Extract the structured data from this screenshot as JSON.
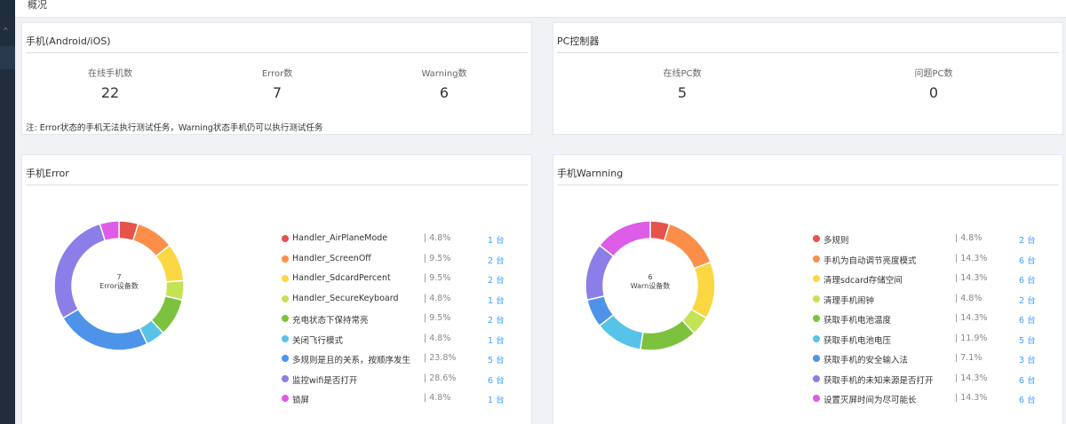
{
  "breadcrumb": "概况",
  "phones": {
    "title": "手机(Android/iOS)",
    "stats": [
      {
        "label": "在线手机数",
        "value": "22"
      },
      {
        "label": "Error数",
        "value": "7"
      },
      {
        "label": "Warning数",
        "value": "6"
      }
    ],
    "note": "注: Error状态的手机无法执行测试任务，Warning状态手机仍可以执行测试任务"
  },
  "pc": {
    "title": "PC控制器",
    "stats": [
      {
        "label": "在线PC数",
        "value": "5"
      },
      {
        "label": "问题PC数",
        "value": "0"
      }
    ]
  },
  "error_chart": {
    "title": "手机Error",
    "center_value": "7",
    "center_label": "Error设备数"
  },
  "warn_chart": {
    "title": "手机Warnning",
    "center_value": "6",
    "center_label": "Warn设备数"
  },
  "chart_data": [
    {
      "type": "pie",
      "title": "手机Error",
      "unit": "台",
      "items": [
        {
          "name": "Handler_AirPlaneMode",
          "percent": "| 4.8%",
          "count": "1 台",
          "value": 4.8,
          "color": "#e5534b"
        },
        {
          "name": "Handler_ScreenOff",
          "percent": "| 9.5%",
          "count": "2 台",
          "value": 9.5,
          "color": "#fb8f4a"
        },
        {
          "name": "Handler_SdcardPercent",
          "percent": "| 9.5%",
          "count": "2 台",
          "value": 9.5,
          "color": "#fcd744"
        },
        {
          "name": "Handler_SecureKeyboard",
          "percent": "| 4.8%",
          "count": "1 台",
          "value": 4.8,
          "color": "#c3e355"
        },
        {
          "name": "充电状态下保持常亮",
          "percent": "| 9.5%",
          "count": "2 台",
          "value": 9.5,
          "color": "#7cc23f"
        },
        {
          "name": "关闭飞行模式",
          "percent": "| 4.8%",
          "count": "1 台",
          "value": 4.8,
          "color": "#57c3e8"
        },
        {
          "name": "多规则是且的关系，按顺序发生",
          "percent": "| 23.8%",
          "count": "5 台",
          "value": 23.8,
          "color": "#4e93ea"
        },
        {
          "name": "监控wifi是否打开",
          "percent": "| 28.6%",
          "count": "6 台",
          "value": 28.6,
          "color": "#8c7ee8"
        },
        {
          "name": "锁屏",
          "percent": "| 4.8%",
          "count": "1 台",
          "value": 4.8,
          "color": "#dd5ce8"
        }
      ]
    },
    {
      "type": "pie",
      "title": "手机Warnning",
      "unit": "台",
      "items": [
        {
          "name": "多规则",
          "percent": "| 4.8%",
          "count": "2 台",
          "value": 4.8,
          "color": "#e5534b"
        },
        {
          "name": "手机为自动调节亮度模式",
          "percent": "| 14.3%",
          "count": "6 台",
          "value": 14.3,
          "color": "#fb8f4a"
        },
        {
          "name": "清理sdcard存储空间",
          "percent": "| 14.3%",
          "count": "6 台",
          "value": 14.3,
          "color": "#fcd744"
        },
        {
          "name": "清理手机闹钟",
          "percent": "| 4.8%",
          "count": "2 台",
          "value": 4.8,
          "color": "#c3e355"
        },
        {
          "name": "获取手机电池温度",
          "percent": "| 14.3%",
          "count": "6 台",
          "value": 14.3,
          "color": "#7cc23f"
        },
        {
          "name": "获取手机电池电压",
          "percent": "| 11.9%",
          "count": "5 台",
          "value": 11.9,
          "color": "#57c3e8"
        },
        {
          "name": "获取手机的安全输入法",
          "percent": "| 7.1%",
          "count": "3 台",
          "value": 7.1,
          "color": "#4e93ea"
        },
        {
          "name": "获取手机的未知来源是否打开",
          "percent": "| 14.3%",
          "count": "6 台",
          "value": 14.3,
          "color": "#8c7ee8"
        },
        {
          "name": "设置灭屏时间为尽可能长",
          "percent": "| 14.3%",
          "count": "6 台",
          "value": 14.3,
          "color": "#dd5ce8"
        }
      ]
    }
  ]
}
